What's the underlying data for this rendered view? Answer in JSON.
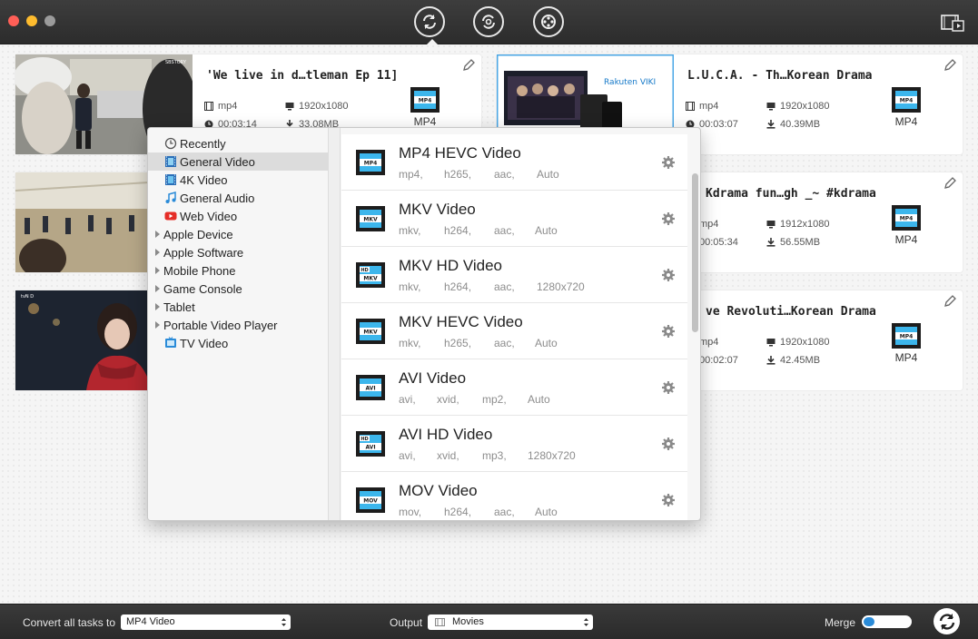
{
  "titlebar": {
    "tools": [
      {
        "name": "convert-tool-icon",
        "active": true
      },
      {
        "name": "download-tool-icon",
        "active": false
      },
      {
        "name": "toolbox-tool-icon",
        "active": false
      }
    ],
    "media_icon": "media-browser-icon"
  },
  "cards": [
    {
      "title": "'We live in d…tleman Ep 11]",
      "format": "mp4",
      "resolution": "1920x1080",
      "duration": "00:03:14",
      "size": "33.08MB",
      "output_format": "MP4"
    },
    {
      "title": "L.U.C.A. - Th…Korean Drama",
      "format": "mp4",
      "resolution": "1920x1080",
      "duration": "00:03:07",
      "size": "40.39MB",
      "output_format": "MP4",
      "thumb_brand": "Rakuten VIKI"
    },
    {
      "title": "Kdrama fun…gh _~ #kdrama",
      "format": "mp4",
      "resolution": "1912x1080",
      "duration": "00:05:34",
      "size": "56.55MB",
      "output_format": "MP4"
    },
    {
      "title": "ve Revoluti…Korean Drama",
      "format": "mp4",
      "resolution": "1920x1080",
      "duration": "00:02:07",
      "size": "42.45MB",
      "output_format": "MP4"
    }
  ],
  "card0_badge_label": "MP4",
  "popup": {
    "categories": [
      {
        "label": "Recently",
        "icon": "clock-icon",
        "group": false,
        "selected": false
      },
      {
        "label": "General Video",
        "icon": "film-icon",
        "group": false,
        "selected": true
      },
      {
        "label": "4K Video",
        "icon": "film-4k-icon",
        "group": false,
        "selected": false
      },
      {
        "label": "General Audio",
        "icon": "music-note-icon",
        "group": false,
        "selected": false
      },
      {
        "label": "Web Video",
        "icon": "youtube-icon",
        "group": false,
        "selected": false
      },
      {
        "label": "Apple Device",
        "icon": "",
        "group": true,
        "selected": false
      },
      {
        "label": "Apple Software",
        "icon": "",
        "group": true,
        "selected": false
      },
      {
        "label": "Mobile Phone",
        "icon": "",
        "group": true,
        "selected": false
      },
      {
        "label": "Game Console",
        "icon": "",
        "group": true,
        "selected": false
      },
      {
        "label": "Tablet",
        "icon": "",
        "group": true,
        "selected": false
      },
      {
        "label": "Portable Video Player",
        "icon": "",
        "group": true,
        "selected": false
      },
      {
        "label": "TV Video",
        "icon": "tv-icon",
        "group": false,
        "selected": false
      }
    ],
    "formats": [
      {
        "name": "MP4 HEVC Video",
        "badge": "MP4",
        "hd": false,
        "specs": [
          "mp4,",
          "h265,",
          "aac,",
          "Auto"
        ]
      },
      {
        "name": "MKV Video",
        "badge": "MKV",
        "hd": false,
        "specs": [
          "mkv,",
          "h264,",
          "aac,",
          "Auto"
        ]
      },
      {
        "name": "MKV HD Video",
        "badge": "MKV",
        "hd": true,
        "specs": [
          "mkv,",
          "h264,",
          "aac,",
          "1280x720"
        ]
      },
      {
        "name": "MKV HEVC Video",
        "badge": "MKV",
        "hd": false,
        "specs": [
          "mkv,",
          "h265,",
          "aac,",
          "Auto"
        ]
      },
      {
        "name": "AVI Video",
        "badge": "AVI",
        "hd": false,
        "specs": [
          "avi,",
          "xvid,",
          "mp2,",
          "Auto"
        ]
      },
      {
        "name": "AVI HD Video",
        "badge": "AVI",
        "hd": true,
        "specs": [
          "avi,",
          "xvid,",
          "mp3,",
          "1280x720"
        ]
      },
      {
        "name": "MOV Video",
        "badge": "MOV",
        "hd": false,
        "specs": [
          "mov,",
          "h264,",
          "aac,",
          "Auto"
        ]
      }
    ]
  },
  "bottombar": {
    "convert_all_label": "Convert all tasks to",
    "convert_all_value": "MP4 Video",
    "output_label": "Output",
    "output_value": "Movies",
    "merge_label": "Merge",
    "merge_on": false
  },
  "colors": {
    "accent": "#2a8bd8",
    "badge_blue": "#29a9e0"
  }
}
